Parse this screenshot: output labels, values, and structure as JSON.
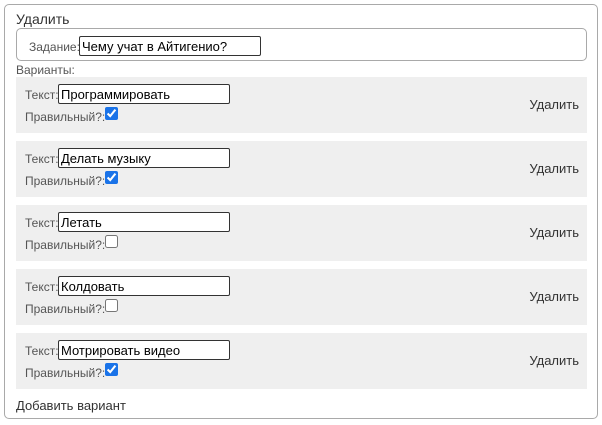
{
  "form": {
    "delete_label": "Удалить",
    "task_label": "Задание:",
    "task_value": "Чему учат в Айтигенио?",
    "variants_label": "Варианты:",
    "add_variant_label": "Добавить вариант"
  },
  "variants": [
    {
      "text_label": "Текст:",
      "text_value": "Программировать",
      "correct_label": "Правильный?:",
      "correct": true,
      "delete_label": "Удалить"
    },
    {
      "text_label": "Текст:",
      "text_value": "Делать музыку",
      "correct_label": "Правильный?:",
      "correct": true,
      "delete_label": "Удалить"
    },
    {
      "text_label": "Текст:",
      "text_value": "Летать",
      "correct_label": "Правильный?:",
      "correct": false,
      "delete_label": "Удалить"
    },
    {
      "text_label": "Текст:",
      "text_value": "Колдовать",
      "correct_label": "Правильный?:",
      "correct": false,
      "delete_label": "Удалить"
    },
    {
      "text_label": "Текст:",
      "text_value": "Мотрировать видео",
      "correct_label": "Правильный?:",
      "correct": true,
      "delete_label": "Удалить"
    }
  ]
}
